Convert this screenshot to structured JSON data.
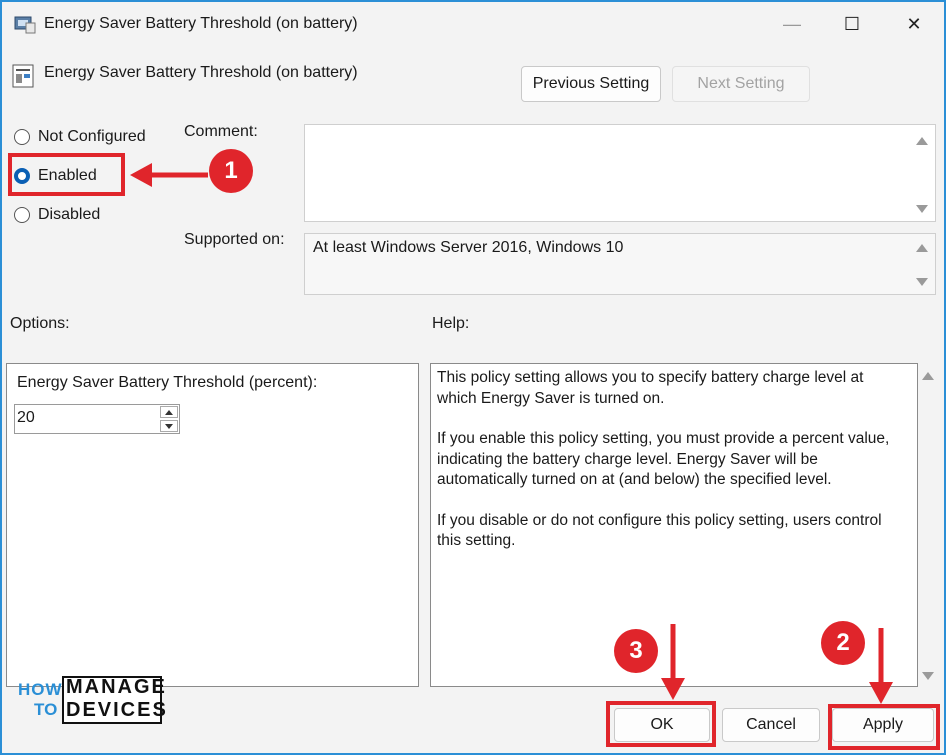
{
  "window": {
    "title": "Energy Saver Battery Threshold (on battery)",
    "minimize": "—",
    "maximize": "☐",
    "close": "✕"
  },
  "header": {
    "setting_name": "Energy Saver Battery Threshold (on battery)",
    "previous_label": "Previous Setting",
    "next_label": "Next Setting"
  },
  "state": {
    "not_configured_label": "Not Configured",
    "enabled_label": "Enabled",
    "disabled_label": "Disabled",
    "selected": "Enabled"
  },
  "comment": {
    "label": "Comment:",
    "value": ""
  },
  "supported": {
    "label": "Supported on:",
    "value": "At least Windows Server 2016, Windows 10"
  },
  "options": {
    "label": "Options:",
    "field_label": "Energy Saver Battery Threshold (percent):",
    "field_value": "20"
  },
  "help": {
    "label": "Help:",
    "paragraphs": [
      "This policy setting allows you to specify battery charge level at which Energy Saver is turned on.",
      "If you enable this policy setting, you must provide a percent value, indicating the battery charge level. Energy Saver will be automatically turned on at (and below) the specified level.",
      "If you disable or do not configure this policy setting, users control this setting."
    ]
  },
  "footer": {
    "ok_label": "OK",
    "cancel_label": "Cancel",
    "apply_label": "Apply"
  },
  "annotations": {
    "step1": "1",
    "step2": "2",
    "step3": "3",
    "accent_color": "#e0252b"
  },
  "logo": {
    "line1": "HOW",
    "line2": "TO",
    "word1": "MANAGE",
    "word2": "DEVICES"
  }
}
